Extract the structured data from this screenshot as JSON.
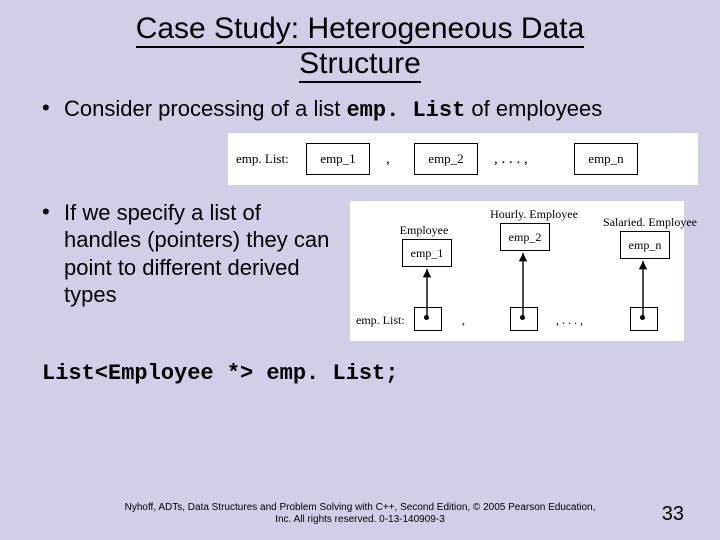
{
  "title_line1": "Case Study: Heterogeneous Data",
  "title_line2": "Structure",
  "bullet1_pre": "Consider processing of a list ",
  "bullet1_code": "emp. List",
  "bullet1_post": " of employees",
  "diagram1": {
    "label": "emp. List:",
    "boxes": [
      "emp_1",
      "emp_2",
      "emp_n"
    ],
    "sep": ",",
    "ell": ", . . . ,"
  },
  "bullet2": "If we specify a list of handles (pointers) they can point to different derived types",
  "diagram2": {
    "types": [
      "Employee",
      "Hourly. Employee",
      "Salaried. Employee"
    ],
    "objs": [
      "emp_1",
      "emp_2",
      "emp_n"
    ],
    "label": "emp. List:",
    "sep": ",",
    "ell": ", . . . ,"
  },
  "declaration": "List<Employee *> emp. List;",
  "footer_cite": "Nyhoff, ADTs, Data Structures and Problem Solving with C++, Second Edition, © 2005 Pearson Education, Inc. All rights reserved. 0-13-140909-3",
  "page_num": "33"
}
